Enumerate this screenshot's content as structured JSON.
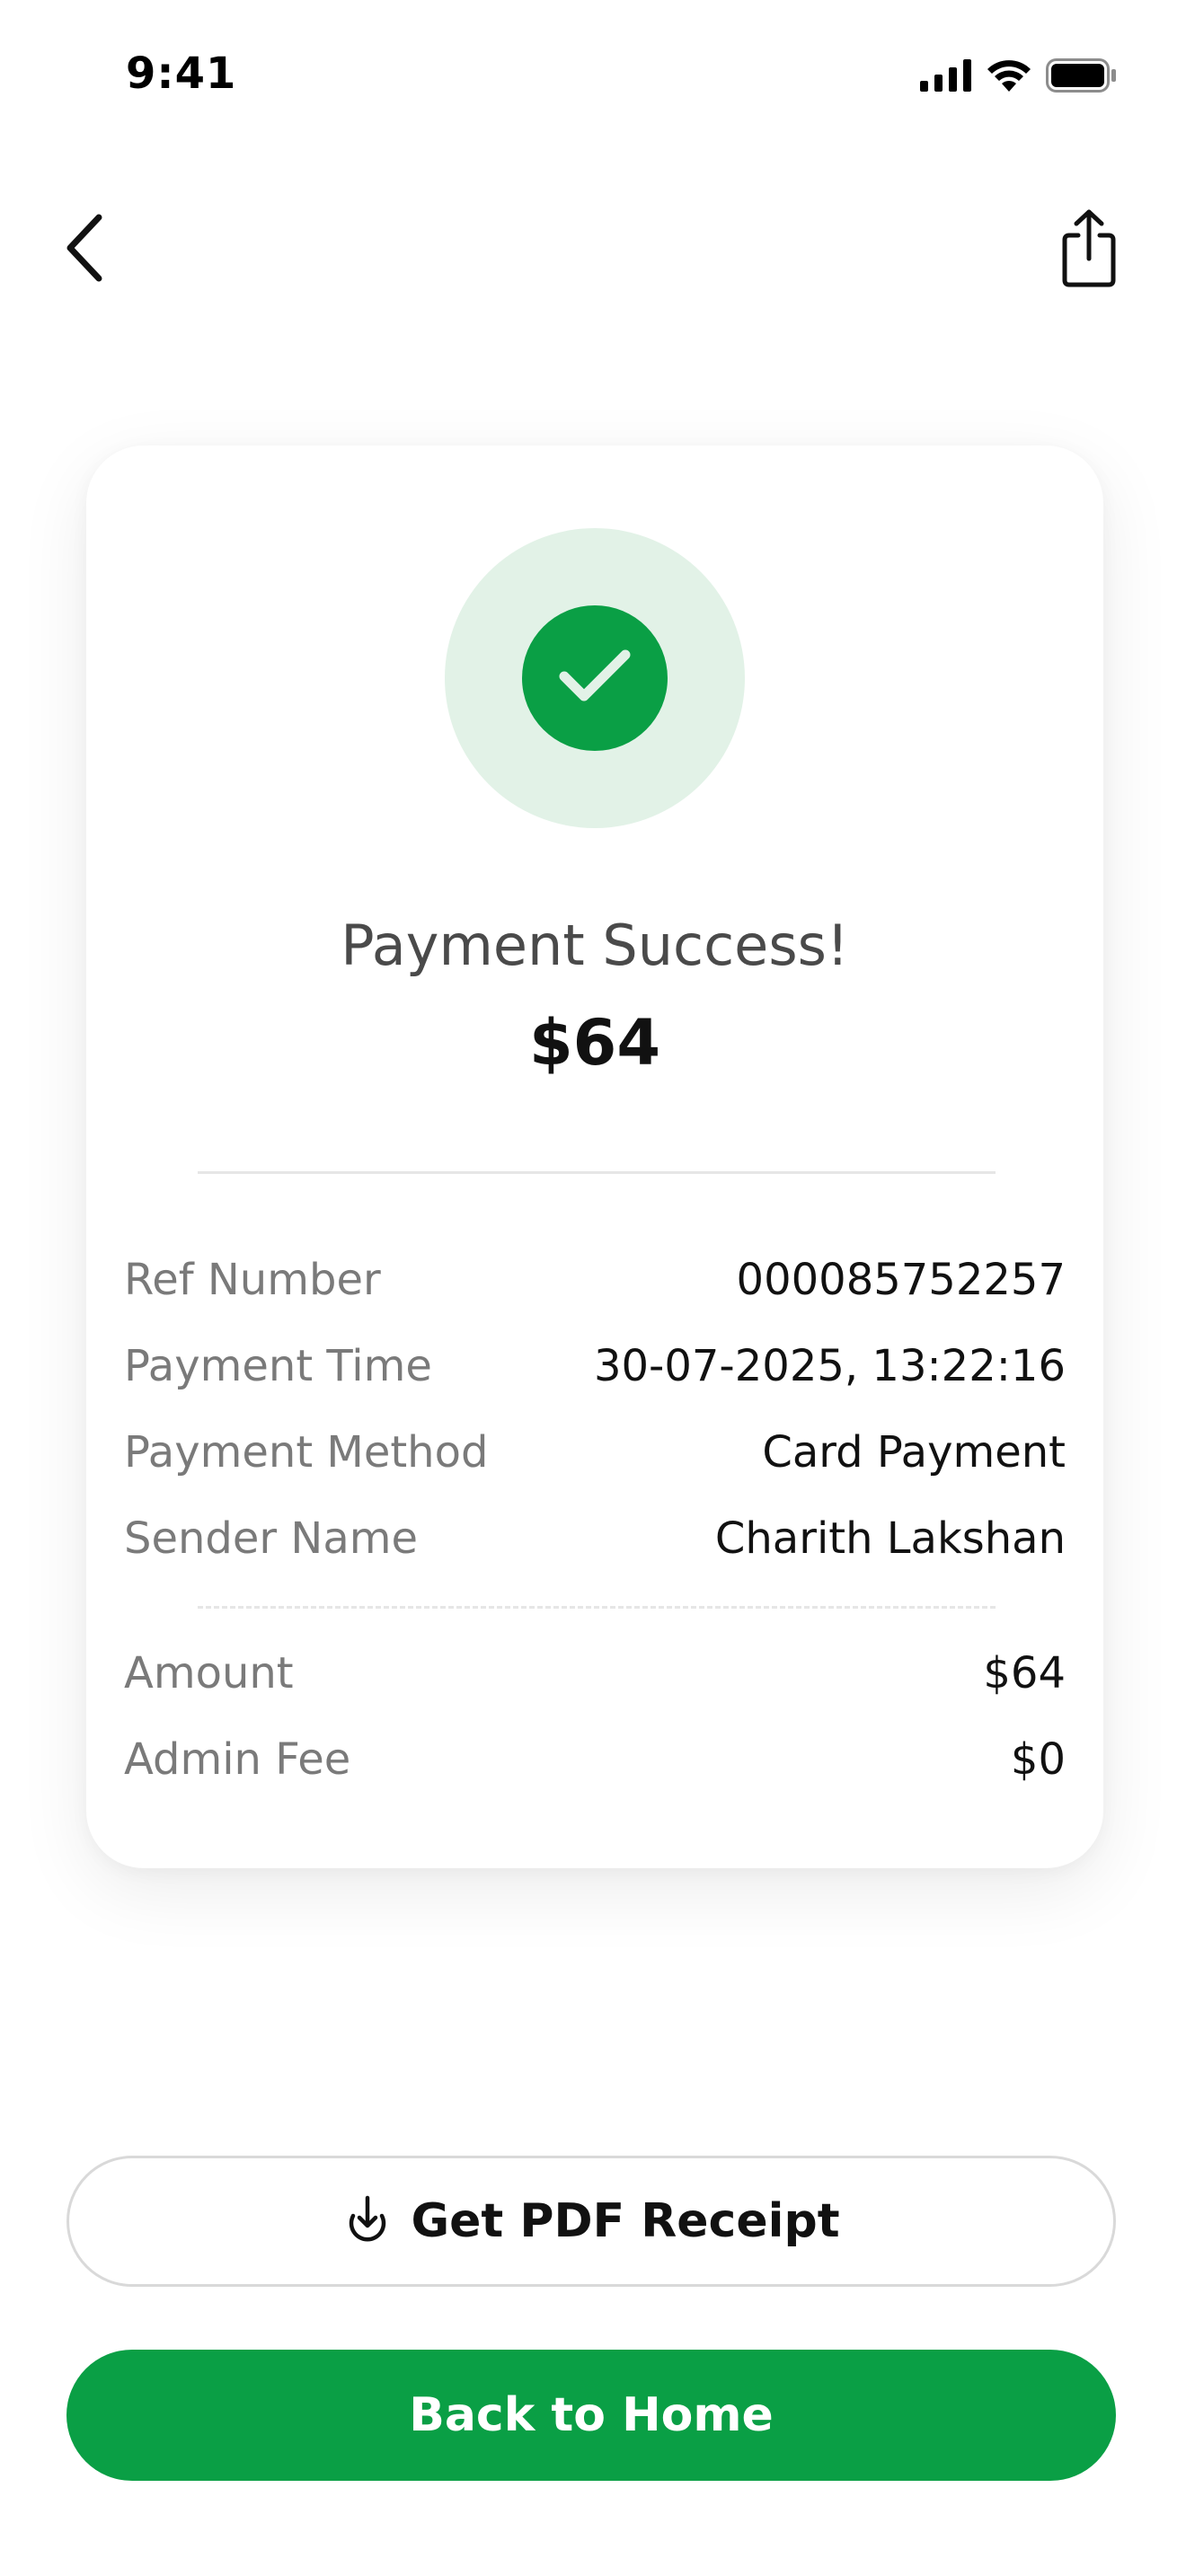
{
  "status_bar": {
    "time": "9:41",
    "icons": [
      "cellular-signal-icon",
      "wifi-icon",
      "battery-icon"
    ]
  },
  "nav": {
    "back_icon": "chevron-left-icon",
    "share_icon": "share-icon"
  },
  "receipt": {
    "status_icon": "check-icon",
    "title": "Payment Success!",
    "amount": "$64",
    "details": [
      {
        "label": "Ref Number",
        "value": "000085752257"
      },
      {
        "label": "Payment Time",
        "value": "30-07-2025, 13:22:16"
      },
      {
        "label": "Payment Method",
        "value": "Card Payment"
      },
      {
        "label": "Sender Name",
        "value": "Charith Lakshan"
      }
    ],
    "totals": [
      {
        "label": "Amount",
        "value": "$64"
      },
      {
        "label": "Admin Fee",
        "value": "$0"
      }
    ]
  },
  "actions": {
    "pdf_receipt_label": "Get PDF Receipt",
    "pdf_receipt_icon": "download-icon",
    "back_home_label": "Back to Home"
  },
  "colors": {
    "accent": "#0a9f45",
    "accent_light": "#e2f2e7",
    "label_gray": "#7a7a7a",
    "title_gray": "#4a4a4a"
  }
}
